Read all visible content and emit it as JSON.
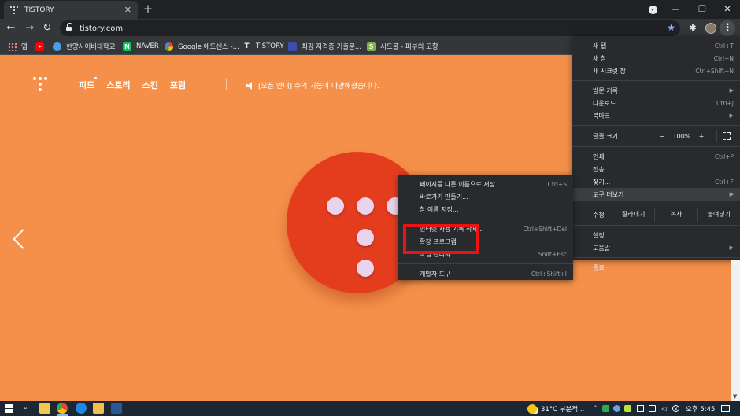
{
  "tab": {
    "title": "TISTORY",
    "close": "✕"
  },
  "window_controls": {
    "minimize": "—",
    "maximize": "❐",
    "close": "✕"
  },
  "toolbar": {
    "back": "←",
    "forward": "→",
    "reload": "↻",
    "url": "tistory.com",
    "star": "★",
    "extensions": "✱",
    "menu": "⋮"
  },
  "bookmarks": [
    {
      "label": "앱",
      "icon": "apps-icon"
    },
    {
      "label": "",
      "icon": "youtube-icon"
    },
    {
      "label": "한양사이버대학교",
      "icon": "hanyang-icon"
    },
    {
      "label": "NAVER",
      "icon": "naver-icon",
      "glyph": "N"
    },
    {
      "label": "Google 애드센스 -...",
      "icon": "google-icon"
    },
    {
      "label": "TISTORY",
      "icon": "tistory-icon",
      "glyph": "T"
    },
    {
      "label": "최강 자격증 기출문...",
      "icon": "exam-icon"
    },
    {
      "label": "시드물 - 피부의 고향",
      "icon": "sidmool-icon",
      "glyph": "S"
    }
  ],
  "site": {
    "nav": [
      "피드",
      "스토리",
      "스킨",
      "포럼"
    ],
    "notice": "[오픈 안내] 수익 기능이 다양해졌습니다."
  },
  "main_menu": {
    "new_tab": {
      "label": "새 탭",
      "shortcut": "Ctrl+T"
    },
    "new_window": {
      "label": "새 창",
      "shortcut": "Ctrl+N"
    },
    "incognito": {
      "label": "새 시크릿 창",
      "shortcut": "Ctrl+Shift+N"
    },
    "history": {
      "label": "방문 기록"
    },
    "downloads": {
      "label": "다운로드",
      "shortcut": "Ctrl+J"
    },
    "bookmarks": {
      "label": "북마크"
    },
    "zoom": {
      "label": "글꼴 크기",
      "minus": "−",
      "value": "100%",
      "plus": "+"
    },
    "print": {
      "label": "인쇄",
      "shortcut": "Ctrl+P"
    },
    "cast": {
      "label": "전송..."
    },
    "find": {
      "label": "찾기...",
      "shortcut": "Ctrl+F"
    },
    "more_tools": {
      "label": "도구 더보기"
    },
    "edit": {
      "label": "수정",
      "cut": "잘라내기",
      "copy": "복사",
      "paste": "붙여넣기"
    },
    "settings": {
      "label": "설정"
    },
    "help": {
      "label": "도움말"
    },
    "exit": {
      "label": "종료"
    },
    "arrow": "▶"
  },
  "sub_menu": {
    "save_page": {
      "label": "페이지를 다른 이름으로 저장...",
      "shortcut": "Ctrl+S"
    },
    "create_shortcut": {
      "label": "바로가기 만들기..."
    },
    "name_window": {
      "label": "창 이름 지정..."
    },
    "clear_data": {
      "label": "인터넷 사용 기록 삭제...",
      "shortcut": "Ctrl+Shift+Del"
    },
    "extensions": {
      "label": "확장 프로그램"
    },
    "task_manager": {
      "label": "작업 관리자",
      "shortcut": "Shift+Esc"
    },
    "dev_tools": {
      "label": "개발자 도구",
      "shortcut": "Ctrl+Shift+I"
    }
  },
  "taskbar": {
    "weather": "31°C 부분적...",
    "time": "오후 5:45",
    "colors": {
      "taskbar": "#1b2733"
    }
  },
  "colors": {
    "page_bg": "#f5904a",
    "disc": "#e43d1e",
    "highlight": "#ee1111",
    "menu_bg": "#292a2d"
  }
}
